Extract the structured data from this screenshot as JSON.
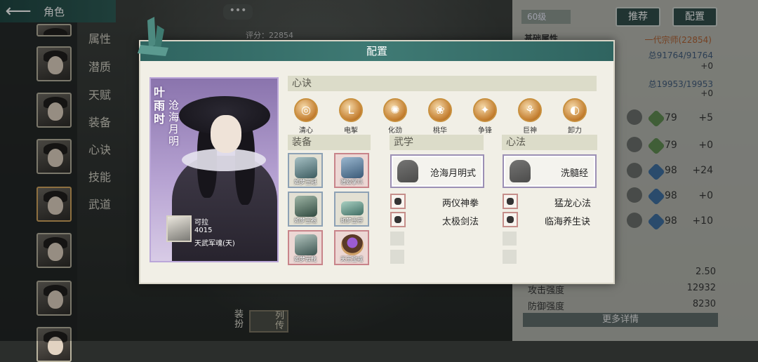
{
  "header": {
    "title": "角色",
    "chat": "•••"
  },
  "side_menu": [
    "属性",
    "潜质",
    "天赋",
    "装备",
    "心诀",
    "技能",
    "武道"
  ],
  "right_panel": {
    "level": "60级",
    "recommend": "推荐",
    "config": "配置",
    "score_label": "评分：22854",
    "base_attr": "基础属性",
    "rank": "一代宗师(22854)",
    "hp": "总91764/91764",
    "hp_delta": "+0",
    "mp": "总19953/19953",
    "mp_delta": "+0",
    "stats": [
      {
        "value": "79",
        "delta": "+5"
      },
      {
        "value": "79",
        "delta": "+0"
      },
      {
        "value": "98",
        "delta": "+24"
      },
      {
        "value": "98",
        "delta": "+0"
      },
      {
        "value": "98",
        "delta": "+10"
      }
    ],
    "extra_value": "2.50",
    "attack_label": "攻击强度",
    "attack_value": "12932",
    "defense_label": "防御强度",
    "defense_value": "8230",
    "more": "更多详情"
  },
  "bottom_tools": {
    "equip": "装扮",
    "biography": "列传"
  },
  "modal": {
    "title": "配置",
    "character": {
      "name": "叶雨时",
      "title": "沧海月明",
      "item_name": "可拉",
      "item_num": "4015",
      "item_tag": "天武军魂(天)"
    },
    "heart_section": "心诀",
    "heart_skills": [
      {
        "label": "清心",
        "glyph": "◎"
      },
      {
        "label": "电掣",
        "glyph": "L"
      },
      {
        "label": "化劲",
        "glyph": "✺"
      },
      {
        "label": "桃华",
        "glyph": "❀"
      },
      {
        "label": "争锋",
        "glyph": "✦"
      },
      {
        "label": "巨神",
        "glyph": "⚘"
      },
      {
        "label": "卸力",
        "glyph": "◐"
      }
    ],
    "equip_section": "装备",
    "equipment": [
      {
        "name": "如梦玉冠",
        "style": "blue"
      },
      {
        "name": "潜蛟掌爪",
        "style": "rare"
      },
      {
        "name": "如梦玉袍",
        "style": "blue"
      },
      {
        "name": "如梦玉带",
        "style": "blue"
      },
      {
        "name": "如梦云靴",
        "style": "rare"
      },
      {
        "name": "天王宝戒",
        "style": "rare"
      }
    ],
    "martial_section": "武学",
    "martial_main": "沧海月明式",
    "martial_subs": [
      "两仪神拳",
      "太极剑法"
    ],
    "method_section": "心法",
    "method_main": "洗髓经",
    "method_subs": [
      "猛龙心法",
      "临海养生诀"
    ]
  }
}
